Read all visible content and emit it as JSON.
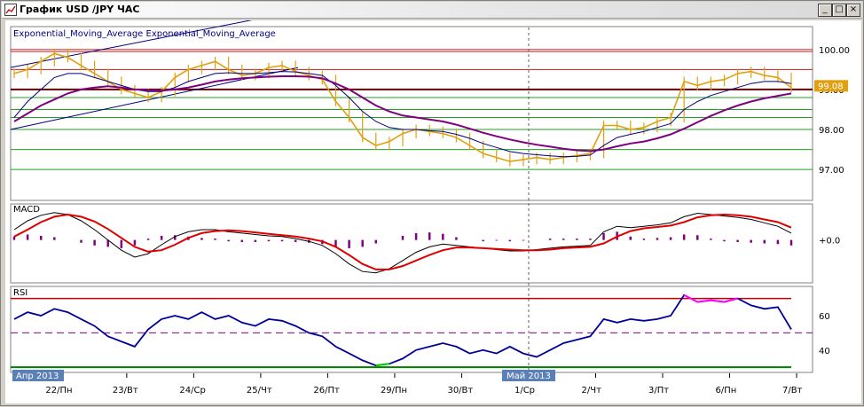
{
  "window": {
    "title": "График USD /JPY ЧАС",
    "buttons": {
      "minimize": "_",
      "maximize": "□",
      "close": "×"
    }
  },
  "colors": {
    "price": "#e0a010",
    "ema_fast": "#000080",
    "ema_slow": "#800080",
    "support_line": "#1fa01f",
    "resistance_line": "#c02020",
    "current_line": "#600000",
    "trend_line": "#000080",
    "macd_line": "#000000",
    "macd_signal": "#e00000",
    "macd_hist": "#800080",
    "rsi_line": "#000099",
    "rsi_overbought": "#ff00ff",
    "rsi_oversold": "#00cc00"
  },
  "chart_data": [
    {
      "type": "line",
      "panel": "price",
      "legend": "Exponential_Moving_Average Exponential_Moving_Average",
      "ylim": [
        96.25,
        100.55
      ],
      "yticks": [
        97.0,
        98.0,
        99.0,
        100.0
      ],
      "ytick_labels": [
        "97.00",
        "98.00",
        "99.00",
        "100.00"
      ],
      "current_price_label": "99.08",
      "current_price": 99.08,
      "x_count": 54,
      "x_labels": [
        {
          "i": 3,
          "label": "22/Пн"
        },
        {
          "i": 8,
          "label": "23/Вт"
        },
        {
          "i": 13,
          "label": "24/Ср"
        },
        {
          "i": 18,
          "label": "25/Чт"
        },
        {
          "i": 23,
          "label": "26/Пт"
        },
        {
          "i": 28,
          "label": "29/Пн"
        },
        {
          "i": 33,
          "label": "30/Вт"
        },
        {
          "i": 38,
          "label": "1/Ср"
        },
        {
          "i": 43,
          "label": "2/Чт"
        },
        {
          "i": 48,
          "label": "3/Пт"
        },
        {
          "i": 53,
          "label": "6/Пн"
        },
        {
          "i": 58,
          "label": "7/Вт"
        }
      ],
      "horizontal_levels": {
        "resistance": [
          99.95,
          100.0,
          99.5
        ],
        "current": 99.0,
        "support": [
          98.8,
          98.5,
          98.3,
          98.0,
          97.5,
          97.0
        ]
      },
      "price": [
        99.4,
        99.5,
        99.7,
        99.9,
        99.8,
        99.6,
        99.4,
        99.2,
        99.0,
        98.9,
        98.8,
        98.95,
        99.3,
        99.5,
        99.6,
        99.7,
        99.5,
        99.35,
        99.4,
        99.55,
        99.6,
        99.45,
        99.35,
        99.25,
        98.7,
        98.3,
        97.8,
        97.6,
        97.7,
        97.9,
        98.0,
        97.95,
        97.9,
        97.8,
        97.6,
        97.4,
        97.3,
        97.2,
        97.25,
        97.3,
        97.25,
        97.3,
        97.35,
        97.4,
        98.1,
        98.1,
        98.0,
        98.05,
        98.2,
        98.3,
        99.2,
        99.1,
        99.2,
        99.25,
        99.4,
        99.45,
        99.35,
        99.3,
        99.05
      ],
      "ema_fast": [
        98.3,
        98.7,
        99.0,
        99.3,
        99.4,
        99.4,
        99.3,
        99.2,
        99.1,
        99.0,
        98.95,
        98.95,
        99.05,
        99.2,
        99.3,
        99.4,
        99.42,
        99.4,
        99.4,
        99.42,
        99.45,
        99.44,
        99.4,
        99.35,
        99.1,
        98.8,
        98.45,
        98.2,
        98.05,
        98.0,
        98.0,
        97.97,
        97.95,
        97.88,
        97.78,
        97.65,
        97.55,
        97.45,
        97.4,
        97.37,
        97.34,
        97.32,
        97.33,
        97.36,
        97.6,
        97.8,
        97.88,
        97.95,
        98.05,
        98.15,
        98.5,
        98.7,
        98.85,
        98.95,
        99.05,
        99.15,
        99.2,
        99.2,
        99.15
      ],
      "ema_slow": [
        98.2,
        98.4,
        98.6,
        98.75,
        98.9,
        99.0,
        99.05,
        99.08,
        99.05,
        99.0,
        98.98,
        98.97,
        99.0,
        99.05,
        99.12,
        99.2,
        99.25,
        99.28,
        99.3,
        99.32,
        99.33,
        99.33,
        99.32,
        99.28,
        99.15,
        99.0,
        98.8,
        98.6,
        98.45,
        98.35,
        98.3,
        98.25,
        98.2,
        98.12,
        98.02,
        97.92,
        97.83,
        97.75,
        97.68,
        97.62,
        97.57,
        97.52,
        97.48,
        97.46,
        97.5,
        97.58,
        97.65,
        97.7,
        97.78,
        97.88,
        98.02,
        98.18,
        98.34,
        98.48,
        98.6,
        98.7,
        98.78,
        98.84,
        98.9
      ]
    },
    {
      "type": "line",
      "panel": "macd",
      "legend": "MACD",
      "ylim": [
        -0.6,
        0.5
      ],
      "yticks": [
        0.0
      ],
      "ytick_labels": [
        "+0.0"
      ],
      "macd": [
        0.15,
        0.28,
        0.36,
        0.4,
        0.37,
        0.28,
        0.15,
        0.0,
        -0.15,
        -0.25,
        -0.2,
        -0.07,
        0.05,
        0.12,
        0.15,
        0.15,
        0.12,
        0.1,
        0.08,
        0.06,
        0.05,
        0.02,
        -0.02,
        -0.08,
        -0.2,
        -0.35,
        -0.46,
        -0.48,
        -0.42,
        -0.3,
        -0.18,
        -0.1,
        -0.06,
        -0.08,
        -0.1,
        -0.12,
        -0.14,
        -0.16,
        -0.16,
        -0.14,
        -0.12,
        -0.1,
        -0.09,
        -0.08,
        0.12,
        0.2,
        0.18,
        0.2,
        0.22,
        0.25,
        0.34,
        0.39,
        0.37,
        0.35,
        0.33,
        0.3,
        0.25,
        0.2,
        0.1
      ],
      "signal": [
        0.05,
        0.15,
        0.26,
        0.34,
        0.37,
        0.34,
        0.27,
        0.16,
        0.03,
        -0.1,
        -0.17,
        -0.15,
        -0.07,
        0.03,
        0.1,
        0.13,
        0.14,
        0.13,
        0.11,
        0.09,
        0.07,
        0.05,
        0.02,
        -0.02,
        -0.1,
        -0.22,
        -0.35,
        -0.43,
        -0.43,
        -0.38,
        -0.3,
        -0.22,
        -0.15,
        -0.11,
        -0.11,
        -0.12,
        -0.13,
        -0.14,
        -0.15,
        -0.15,
        -0.14,
        -0.12,
        -0.11,
        -0.1,
        -0.05,
        0.05,
        0.13,
        0.17,
        0.19,
        0.21,
        0.26,
        0.33,
        0.36,
        0.37,
        0.36,
        0.34,
        0.3,
        0.26,
        0.18
      ],
      "histogram": [
        0.05,
        0.08,
        0.06,
        0.04,
        0.0,
        -0.04,
        -0.08,
        -0.1,
        -0.12,
        -0.08,
        0.02,
        0.06,
        0.07,
        0.05,
        0.03,
        0.02,
        -0.02,
        -0.03,
        -0.03,
        -0.02,
        -0.02,
        -0.03,
        -0.04,
        -0.06,
        -0.1,
        -0.12,
        -0.1,
        -0.05,
        0.0,
        0.06,
        0.1,
        0.11,
        0.09,
        0.04,
        0.0,
        -0.02,
        -0.01,
        -0.02,
        -0.01,
        0.0,
        0.02,
        0.02,
        0.02,
        0.02,
        0.1,
        0.12,
        0.05,
        0.02,
        0.03,
        0.04,
        0.08,
        0.07,
        0.02,
        -0.02,
        -0.03,
        -0.04,
        -0.05,
        -0.06,
        -0.08
      ]
    },
    {
      "type": "line",
      "panel": "rsi",
      "legend": "RSI",
      "ylim": [
        28,
        76
      ],
      "yticks": [
        40,
        60
      ],
      "ytick_labels": [
        "40",
        "60"
      ],
      "levels": {
        "upper": 70,
        "middle": 50,
        "lower": 30
      },
      "rsi": [
        58,
        62,
        60,
        64,
        62,
        58,
        54,
        48,
        45,
        42,
        52,
        58,
        60,
        58,
        62,
        58,
        60,
        56,
        54,
        58,
        57,
        54,
        50,
        48,
        42,
        38,
        34,
        31,
        32,
        35,
        40,
        42,
        44,
        42,
        38,
        40,
        38,
        42,
        38,
        36,
        40,
        44,
        46,
        48,
        58,
        56,
        58,
        57,
        58,
        60,
        72,
        68,
        69,
        68,
        70,
        66,
        64,
        65,
        52
      ],
      "overbought_segments": [
        [
          50,
          54
        ]
      ],
      "oversold_segments": [
        [
          27,
          28
        ]
      ]
    }
  ],
  "bottom_labels": {
    "left_date": "Апр 2013",
    "mid_date": "Май 2013"
  }
}
